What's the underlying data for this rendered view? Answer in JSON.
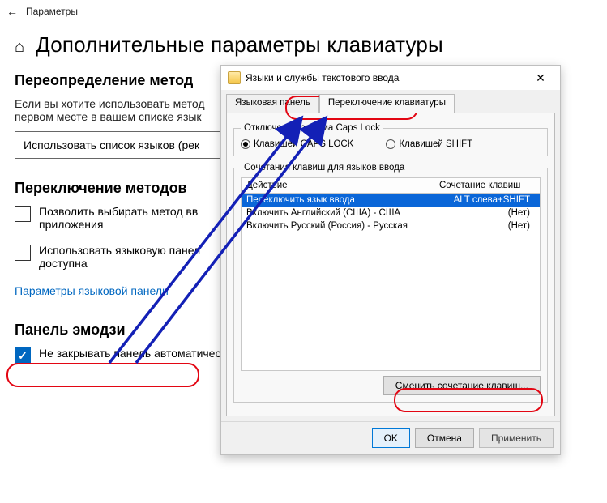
{
  "topbar": {
    "back_glyph": "←",
    "title": "Параметры"
  },
  "page": {
    "home_glyph": "⌂",
    "title": "Дополнительные параметры клавиатуры"
  },
  "sections": {
    "override": {
      "heading": "Переопределение метод",
      "body": "Если вы хотите использовать метод\nпервом месте в вашем списке язык",
      "dropdown": "Использовать список языков (рек"
    },
    "switching": {
      "heading": "Переключение методов ",
      "chk1": "Позволить выбирать метод вв приложения",
      "chk2": "Использовать языковую панел доступна",
      "link": "Параметры языковой панели"
    },
    "emoji": {
      "heading": "Панель эмодзи",
      "chk": "Не закрывать панель автоматически после ввода эмодзи"
    }
  },
  "dialog": {
    "title": "Языки и службы текстового ввода",
    "close_glyph": "✕",
    "tabs": {
      "t1": "Языковая панель",
      "t2": "Переключение клавиатуры"
    },
    "caps_group": {
      "legend": "Отключение режима Caps Lock",
      "r1": "Клавишей CAPS LOCK",
      "r2": "Клавишей SHIFT"
    },
    "hotkeys_group": {
      "legend": "Сочетания клавиш для языков ввода",
      "col_action": "Действие",
      "col_keys": "Сочетание клавиш",
      "rows": [
        {
          "action": "Переключить язык ввода",
          "keys": "ALT слева+SHIFT"
        },
        {
          "action": "Включить Английский (США) - США",
          "keys": "(Нет)"
        },
        {
          "action": "Включить Русский (Россия) - Русская",
          "keys": "(Нет)"
        }
      ],
      "change_btn": "Сменить сочетание клавиш..."
    },
    "buttons": {
      "ok": "OK",
      "cancel": "Отмена",
      "apply": "Применить"
    }
  }
}
